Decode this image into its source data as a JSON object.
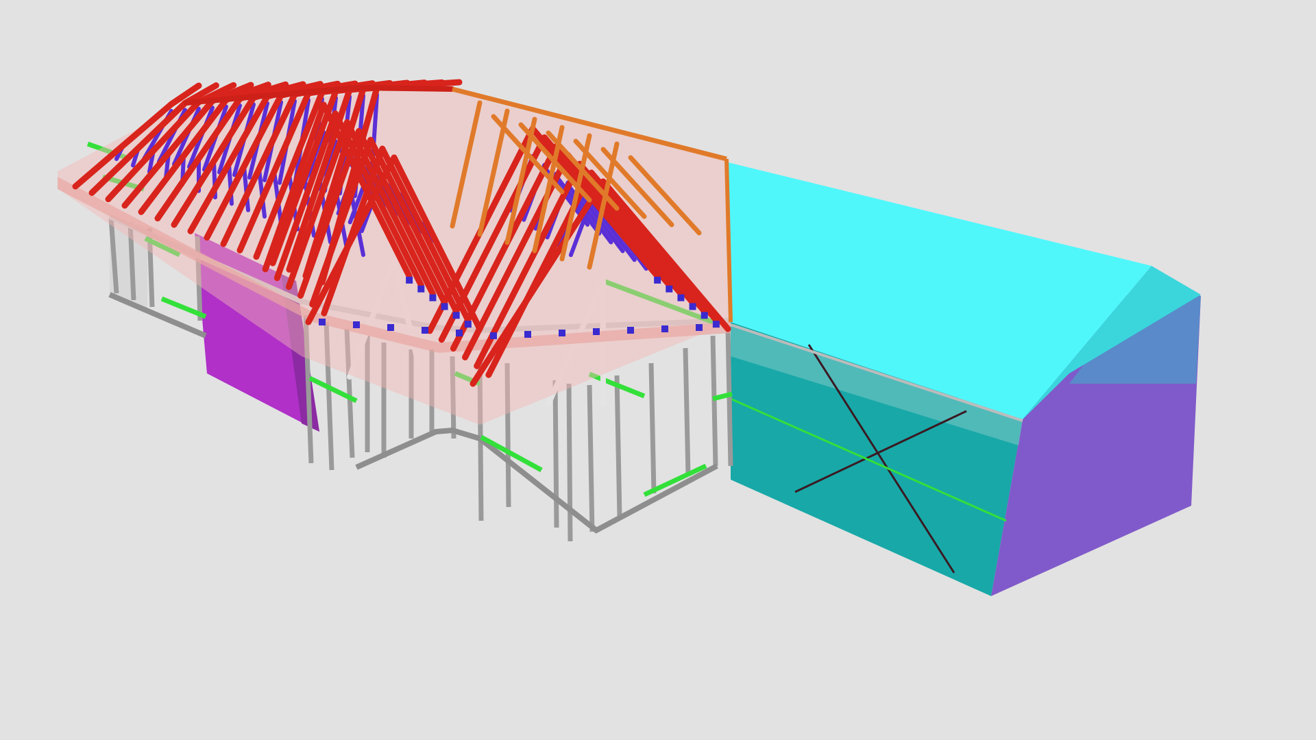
{
  "viewer": {
    "background": "#e2e2e2"
  },
  "model": {
    "colors": {
      "top_chord": "#d8241c",
      "web_member": "#5a2fd6",
      "girder_truss": "#e07a2a",
      "wall_stud": "#9a9a9a",
      "wall_plate": "#cfcfcf",
      "noggin": "#33e03a",
      "cladding_cyan": "#4ff7fb",
      "wall_teal": "#18a8a8",
      "gable_purple": "#7a52c8",
      "wall_magenta": "#b030c8",
      "roof_sheet": "#f3b9b5",
      "brace": "#7a1f2a"
    },
    "layers": [
      {
        "name": "roof-sheeting",
        "icon": "roof-plane-icon"
      },
      {
        "name": "truss-top-chords",
        "icon": "truss-icon"
      },
      {
        "name": "truss-webs",
        "icon": "truss-icon"
      },
      {
        "name": "wall-frames",
        "icon": "wall-frame-icon"
      },
      {
        "name": "noggins",
        "icon": "line-icon"
      },
      {
        "name": "cladding",
        "icon": "box-icon"
      }
    ]
  }
}
